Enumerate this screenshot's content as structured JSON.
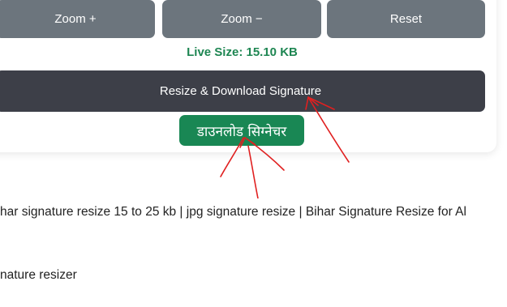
{
  "toolbar": {
    "zoom_in_label": "Zoom +",
    "zoom_out_label": "Zoom −",
    "reset_label": "Reset"
  },
  "status": {
    "live_size": "Live Size: 15.10 KB"
  },
  "actions": {
    "resize_download_label": "Resize & Download Signature",
    "download_hindi_label": "डाउनलोड सिग्नेचर"
  },
  "footer": {
    "line1": "har signature resize 15 to 25 kb | jpg signature resize | Bihar Signature Resize for Al",
    "line2": "nature resizer"
  },
  "colors": {
    "gray_button": "#6c757d",
    "dark_button": "#3d3f48",
    "green_button": "#198754",
    "live_size_text": "#1e8652",
    "annotation_arrows": "#e02020"
  }
}
